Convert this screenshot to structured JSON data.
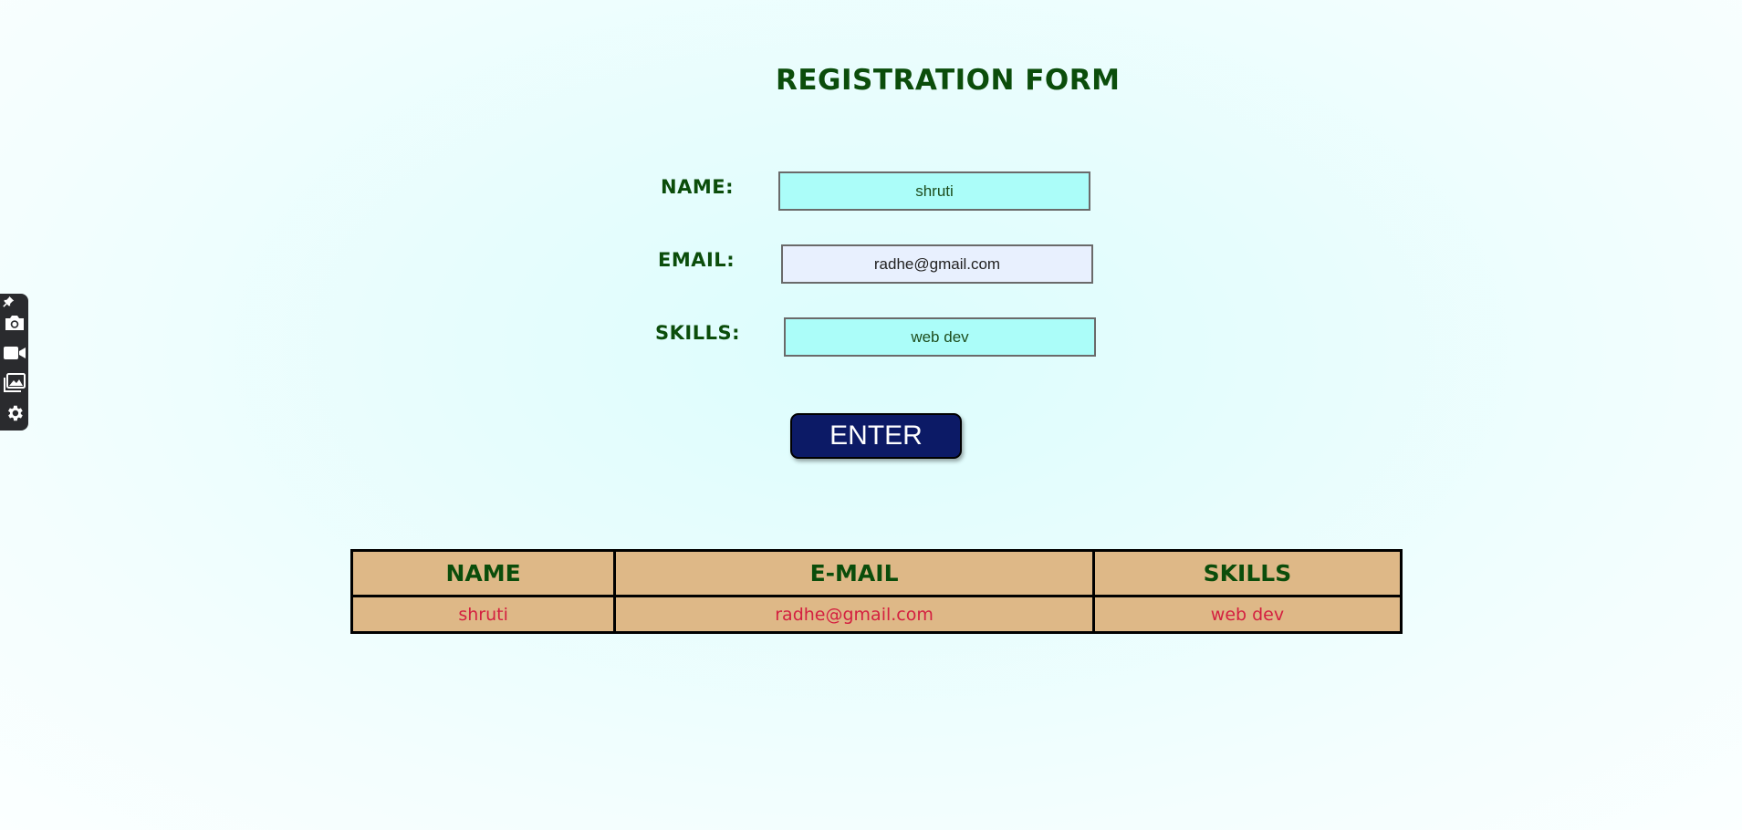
{
  "form": {
    "title": "REGISTRATION FORM",
    "name_label": "NAME:",
    "name_value": "shruti",
    "email_label": "EMAIL:",
    "email_value": "radhe@gmail.com",
    "skills_label": "SKILLS:",
    "skills_value": "web dev",
    "enter_label": "ENTER"
  },
  "table": {
    "headers": [
      "NAME",
      "E-MAIL",
      "SKILLS"
    ],
    "rows": [
      [
        "shruti",
        "radhe@gmail.com",
        "web dev"
      ]
    ]
  },
  "toolbar": {
    "items": [
      "pin-icon",
      "camera-icon",
      "video-icon",
      "gallery-icon",
      "settings-icon"
    ]
  },
  "colors": {
    "label_green": "#0b4d0b",
    "input_cyan": "#abfdf9",
    "input_lavender": "#e8f0fe",
    "button_navy": "#0c1a66",
    "table_tan": "#deb887",
    "cell_red": "#d42040"
  }
}
